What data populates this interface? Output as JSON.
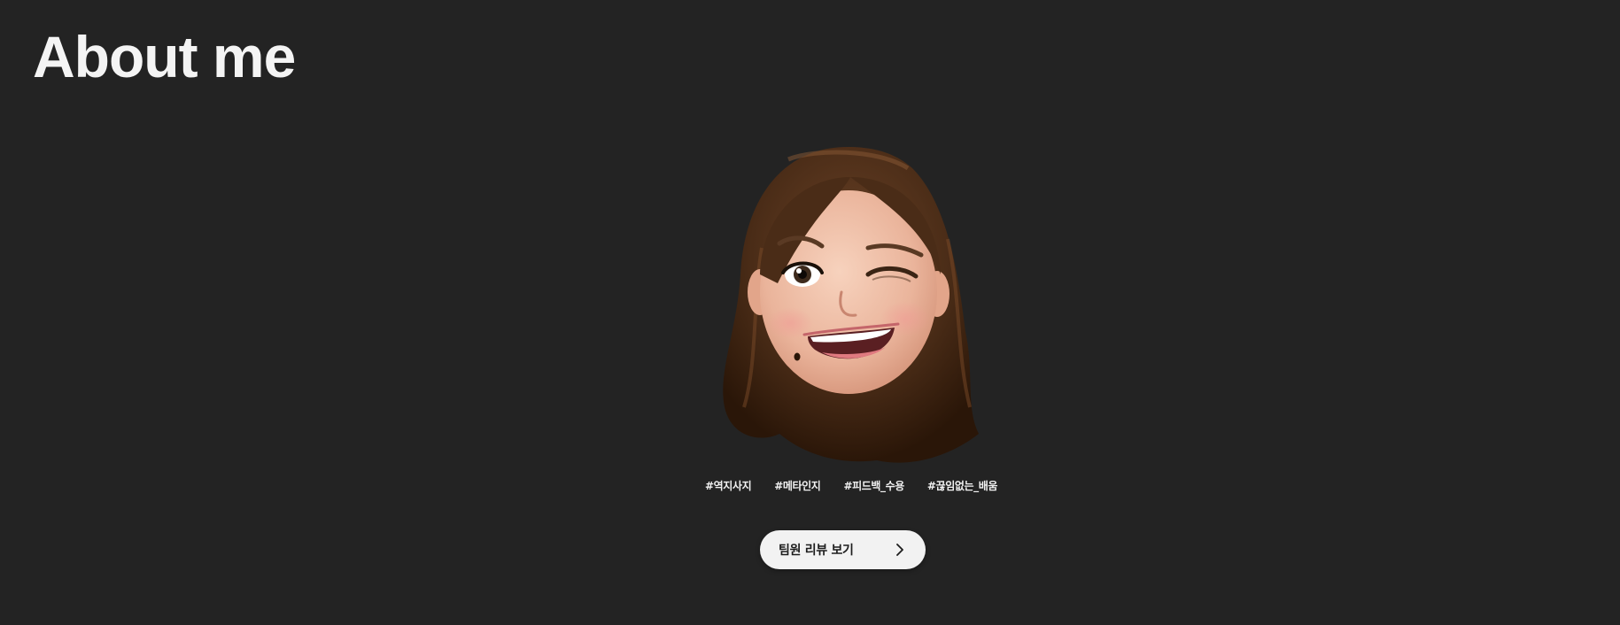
{
  "page": {
    "title": "About me"
  },
  "profile": {
    "avatar_icon": "memoji-winking-avatar",
    "tags": [
      "#역지사지",
      "#메타인지",
      "#피드백_수용",
      "#끊임없는_배움"
    ]
  },
  "actions": {
    "review_button_label": "팀원 리뷰 보기",
    "review_button_icon": "chevron-right-icon"
  },
  "colors": {
    "background": "#232323",
    "title": "#f4f4f4",
    "button_bg": "#f2f2f2",
    "button_text": "#1c1c1c"
  }
}
